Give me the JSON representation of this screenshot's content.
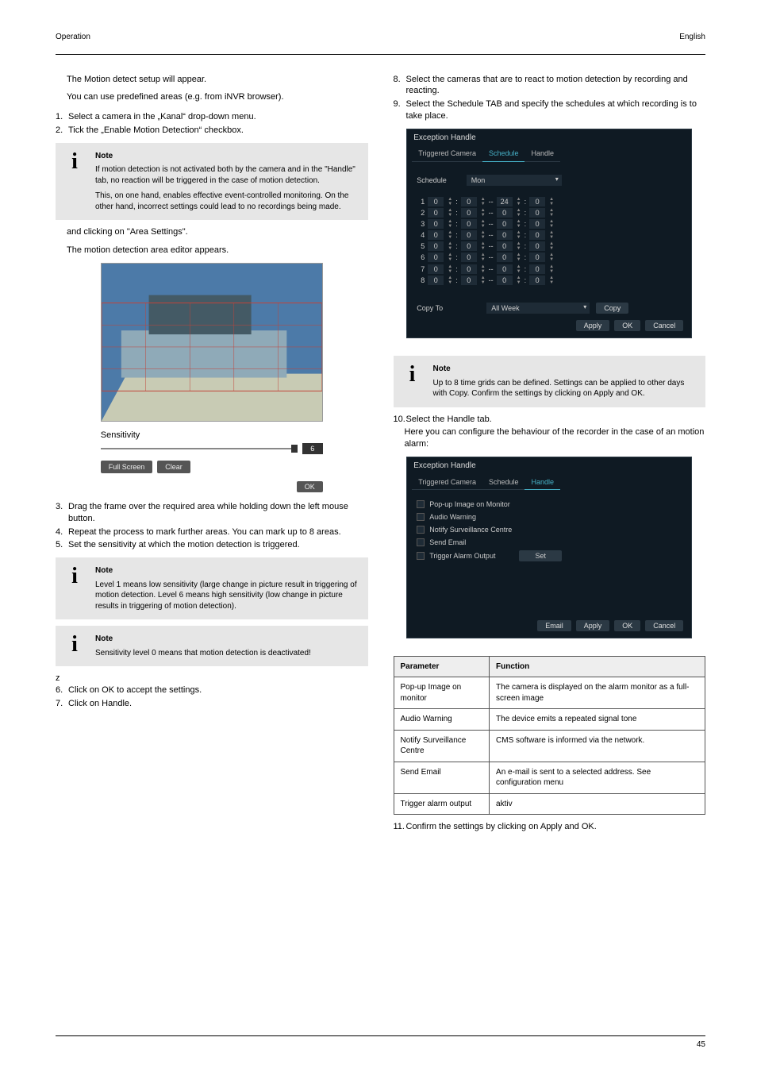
{
  "header": {
    "left": "Operation",
    "right": "English"
  },
  "left": {
    "intro_line1": "The Motion detect setup will appear.",
    "intro_line2": "You can use predefined areas (e.g. from iNVR browser).",
    "step1_num": "1.",
    "step1_txt": "Select a camera in the „Kanal“ drop-down menu.",
    "step2_num": "2.",
    "step2_txt": "Tick the „Enable Motion Detection“ checkbox.",
    "note1_label": "Note",
    "note1_text1": "If motion detection is not activated both by the camera and in the \"Handle\" tab, no reaction will be triggered in the case of motion detection.",
    "note1_text2": "This, on one hand, enables effective event-controlled monitoring. On the other hand, incorrect settings could lead to no recordings being made.",
    "after_step2": "and clicking on \"Area Settings\".",
    "editor_line": "The motion detection area editor appears.",
    "sensitivity_label": "Sensitivity",
    "sensitivity_value": "6",
    "area_btn1": "Full Screen",
    "area_btn2": "Clear",
    "area_ok": "OK",
    "step3_num": "3.",
    "step3_txt": "Drag the frame over the required area while holding down the left mouse button.",
    "step4_num": "4.",
    "step4_txt": "Repeat the process to mark further areas. You can mark up to 8 areas.",
    "step5_num": "5.",
    "step5_txt": "Set the sensitivity at which the motion detection is triggered.",
    "note2_label": "Note",
    "note2_text": "Level 1 means low sensitivity (large change in picture result in triggering of motion detection. Level 6 means high sensitivity (low change in picture results in triggering of motion detection).",
    "note3_label": "Note",
    "note3_text": "Sensitivity level 0 means that motion detection is deactivated!",
    "step6_z": "z",
    "step6_num": "6.",
    "step6_txt": "Click on OK to accept the settings.",
    "step7_num": "7.",
    "step7_txt": "Click on Handle."
  },
  "right": {
    "step8_num": "8.",
    "step8_txt": "Select the cameras that are to react to motion detection by recording and reacting.",
    "step9_num": "9.",
    "step9_txt": "Select the Schedule TAB and specify the schedules at which recording is to take place.",
    "dlg1": {
      "title": "Exception Handle",
      "tab_a": "Triggered Camera",
      "tab_b": "Schedule",
      "tab_c": "Handle",
      "schedule_label": "Schedule",
      "schedule_value": "Mon",
      "copy_label": "Copy To",
      "copy_value": "All Week",
      "copy_btn": "Copy",
      "apply": "Apply",
      "ok": "OK",
      "cancel": "Cancel"
    },
    "note4_label": "Note",
    "note4_text": "Up to 8 time grids can be defined. Settings can be applied to other days with Copy. Confirm the settings by clicking on Apply and OK.",
    "step10_num": "10.",
    "step10_txt": "Select the Handle tab.",
    "handle_intro": "Here you can configure the behaviour of the recorder in the case of an motion alarm:",
    "dlg2": {
      "title": "Exception Handle",
      "tab_a": "Triggered Camera",
      "tab_b": "Schedule",
      "tab_c": "Handle",
      "opt1": "Pop-up Image on Monitor",
      "opt2": "Audio Warning",
      "opt3": "Notify Surveillance Centre",
      "opt4": "Send Email",
      "opt5": "Trigger Alarm Output",
      "set": "Set",
      "email": "Email",
      "apply": "Apply",
      "ok": "OK",
      "cancel": "Cancel"
    },
    "table": {
      "h1": "Parameter",
      "h2": "Function",
      "r1a": "Pop-up Image on monitor",
      "r1b": "The camera is displayed on the alarm monitor as a full-screen image",
      "r2a": "Audio Warning",
      "r2b": "The device emits a repeated signal tone",
      "r3a": "Notify Surveillance Centre",
      "r3b": "CMS software is informed via the network.",
      "r4a": "Send Email",
      "r4b": "An e-mail is sent to a selected address. See configuration menu",
      "r5a": "Trigger alarm output",
      "r5b": "aktiv"
    },
    "step11_num": "11.",
    "step11_txt": "Confirm the settings by clicking on Apply and OK."
  },
  "footer": {
    "page": "45"
  }
}
